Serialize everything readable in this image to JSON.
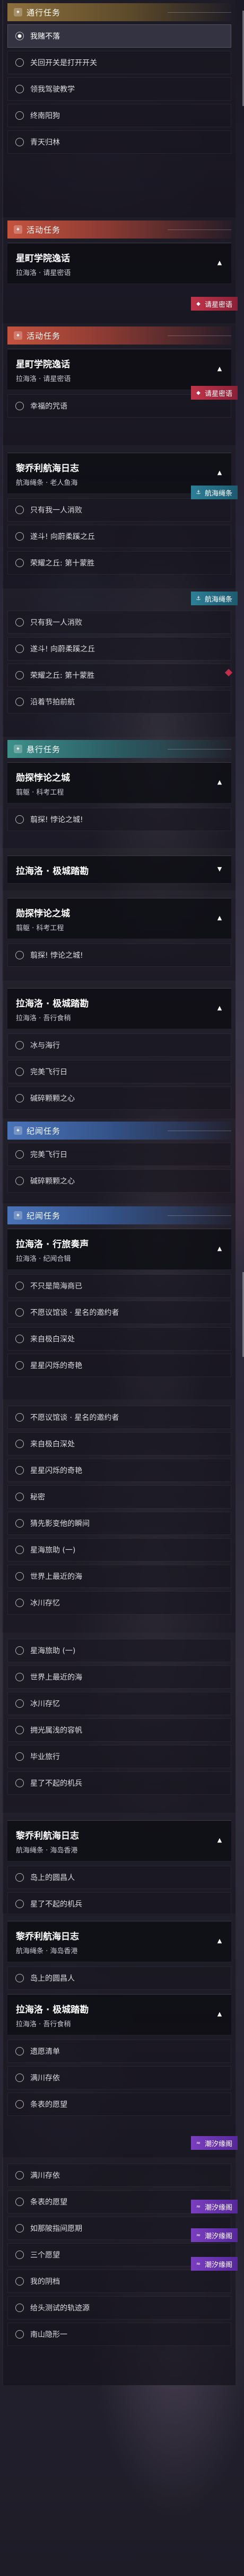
{
  "sections": [
    {
      "id": "s1",
      "header": {
        "text": "通行任务",
        "style": "gold"
      },
      "items": [
        {
          "text": "我赌不落",
          "selected": true
        },
        {
          "text": "关回开关是打开开关"
        },
        {
          "text": "领我驾驶教学"
        },
        {
          "text": "终南阳狗"
        },
        {
          "text": "青天归林"
        }
      ]
    },
    {
      "id": "s2",
      "header": {
        "text": "活动任务",
        "style": "orange"
      },
      "card": {
        "title": "星町学院逸话",
        "subtitle": "拉海洛 · 请星密语"
      },
      "badge": {
        "text": "请星密语",
        "style": "red"
      },
      "items": []
    },
    {
      "id": "s3",
      "header": {
        "text": "活动任务",
        "style": "orange"
      },
      "card": {
        "title": "星町学院逸话",
        "subtitle": "拉海洛 · 请星密语"
      },
      "badge": {
        "text": "请星密语",
        "style": "red"
      },
      "items": [
        {
          "text": "幸福的咒语"
        }
      ]
    },
    {
      "id": "s4",
      "card": {
        "title": "黎乔利航海日志",
        "subtitle": "航海绳条 · 老人鱼海"
      },
      "badge": {
        "text": "航海绳条",
        "style": "teal"
      },
      "items": [
        {
          "text": "只有我一人消败"
        },
        {
          "text": "遂斗! 向蔚柔蹊之丘"
        },
        {
          "text": "荣耀之丘: 第十蒙胜"
        }
      ]
    },
    {
      "id": "s5",
      "badge": {
        "text": "航海绳条",
        "style": "teal"
      },
      "items": [
        {
          "text": "只有我一人消败"
        },
        {
          "text": "遂斗! 向蔚柔蹊之丘"
        },
        {
          "text": "荣耀之丘: 第十蒙胜"
        },
        {
          "text": "沿着节拍前航"
        }
      ]
    },
    {
      "id": "s6",
      "header": {
        "text": "悬行任务",
        "style": "teal"
      },
      "card": {
        "title": "勋探悖论之城",
        "subtitle": "翦躯 · 科考工程"
      },
      "items": [
        {
          "text": "翦探! 悖论之城!"
        }
      ]
    },
    {
      "id": "s7",
      "card": {
        "title": "拉海洛 · 极城踏勘",
        "subtitle": ""
      },
      "items": []
    },
    {
      "id": "s8",
      "card": {
        "title": "勋探悖论之城",
        "subtitle": "翦躯 · 科考工程"
      },
      "items": [
        {
          "text": "翦探! 悖论之城!"
        }
      ]
    },
    {
      "id": "s9",
      "card": {
        "title": "拉海洛 · 极城踏勘",
        "subtitle": "拉海洛 · 吾行食稍"
      },
      "items": [
        {
          "text": "冰与海行"
        },
        {
          "text": "完美飞行日"
        },
        {
          "text": "碱碎颗颗之心"
        }
      ]
    },
    {
      "id": "s10",
      "header": {
        "text": "纪闻任务",
        "style": "blue"
      },
      "items": [
        {
          "text": "完美飞行日"
        },
        {
          "text": "碱碎颗颗之心"
        }
      ]
    },
    {
      "id": "s11",
      "header": {
        "text": "纪闻任务",
        "style": "blue"
      },
      "card": {
        "title": "拉海洛 · 行旅奏声",
        "subtitle": "拉海洛 · 纪闻合辑"
      },
      "items": [
        {
          "text": "不只是简海商已"
        },
        {
          "text": "不愿议馆谈 · 星名的邀约者"
        },
        {
          "text": "来自极白深处"
        },
        {
          "text": "星星闪烁的奇艳"
        }
      ]
    },
    {
      "id": "s12",
      "items": [
        {
          "text": "不愿议馆谈 · 星名的邀约者"
        },
        {
          "text": "来自极白深处"
        },
        {
          "text": "星星闪烁的奇艳"
        },
        {
          "text": "秘密"
        },
        {
          "text": "猜先影变他的瞬间"
        },
        {
          "text": "星海旅助 (一)"
        },
        {
          "text": "世界上最近的海"
        },
        {
          "text": "冰川存忆"
        }
      ]
    },
    {
      "id": "s13",
      "items": [
        {
          "text": "星海旅助 (一)"
        },
        {
          "text": "世界上最近的海"
        },
        {
          "text": "冰川存忆"
        },
        {
          "text": "拥光属浅的容帆"
        },
        {
          "text": "毕业旅行"
        },
        {
          "text": "星了不起的机兵"
        }
      ]
    },
    {
      "id": "s14",
      "card": {
        "title": "黎乔利航海日志",
        "subtitle": "航海绳条 · 海岛香港"
      },
      "items": [
        {
          "text": "岛上的圆昌人"
        },
        {
          "text": "星了不起的机兵"
        }
      ]
    },
    {
      "id": "s15",
      "card": {
        "title": "黎乔利航海日志",
        "subtitle": "航海绳条 · 海岛香港"
      },
      "card2": {
        "title": "拉海洛 · 极城踏勘",
        "subtitle": "拉海洛 · 吾行食稍"
      },
      "items": [
        {
          "text": "岛上的圆昌人"
        }
      ],
      "items2": [
        {
          "text": "遗愿清单"
        },
        {
          "text": "满川存依"
        },
        {
          "text": "条表的愿望"
        }
      ],
      "badge": {
        "text": "潮汐缘阁",
        "style": "purple"
      }
    },
    {
      "id": "s16",
      "items": [
        {
          "text": "满川存依"
        },
        {
          "text": "条表的愿望"
        },
        {
          "text": "如那陂指间愿期"
        },
        {
          "text": "三个愿望"
        },
        {
          "text": "我的阴档"
        },
        {
          "text": "给头测试的轨迹源"
        },
        {
          "text": "南山隐形一"
        }
      ],
      "badges": [
        {
          "text": "潮汐缘阁",
          "style": "purple"
        },
        {
          "text": "潮汐缘阁",
          "style": "purple"
        },
        {
          "text": "潮汐缘阁",
          "style": "purple"
        }
      ]
    }
  ]
}
